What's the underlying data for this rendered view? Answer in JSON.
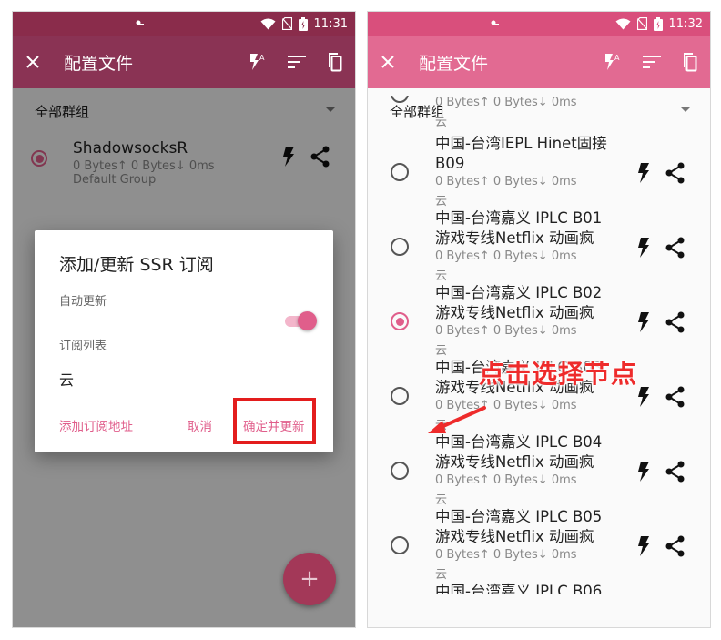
{
  "left": {
    "status": {
      "time": "11:31"
    },
    "appbar": {
      "title": "配置文件"
    },
    "group_selector": "全部群组",
    "proxy": {
      "name": "ShadowsocksR",
      "stats": "0 Bytes↑  0 Bytes↓  0ms",
      "group": "Default Group"
    },
    "dialog": {
      "title": "添加/更新 SSR 订阅",
      "auto_update_label": "自动更新",
      "auto_update_on": true,
      "sub_list_label": "订阅列表",
      "sub_list_value": "云",
      "add_url_button": "添加订阅地址",
      "cancel_button": "取消",
      "confirm_button": "确定并更新"
    },
    "fab_label": "+"
  },
  "right": {
    "status": {
      "time": "11:32"
    },
    "appbar": {
      "title": "配置文件"
    },
    "group_selector": "全部群组",
    "partial_top": {
      "stats": "0 Bytes↑  0 Bytes↓  0ms",
      "group": "云"
    },
    "nodes": [
      {
        "line1": "中国-台湾IEPL Hinet固接",
        "line2": "B09",
        "stats": "0 Bytes↑  0 Bytes↓  0ms",
        "group": "云",
        "selected": false
      },
      {
        "line1": "中国-台湾嘉义 IPLC B01",
        "line2": "游戏专线Netflix 动画疯",
        "stats": "0 Bytes↑  0 Bytes↓  0ms",
        "group": "云",
        "selected": false
      },
      {
        "line1": "中国-台湾嘉义 IPLC B02",
        "line2": "游戏专线Netflix 动画疯",
        "stats": "0 Bytes↑  0 Bytes↓  0ms",
        "group": "云",
        "selected": true
      },
      {
        "line1": "中国-台湾嘉义 IPLC B03",
        "line2": "游戏专线Netflix 动画疯",
        "stats": "0 Bytes↑  0 Bytes↓  0ms",
        "group": "云",
        "selected": false
      },
      {
        "line1": "中国-台湾嘉义 IPLC B04",
        "line2": "游戏专线Netflix 动画疯",
        "stats": "0 Bytes↑  0 Bytes↓  0ms",
        "group": "云",
        "selected": false
      },
      {
        "line1": "中国-台湾嘉义 IPLC B05",
        "line2": "游戏专线Netflix 动画疯",
        "stats": "0 Bytes↑  0 Bytes↓  0ms",
        "group": "云",
        "selected": false
      }
    ],
    "partial_bottom": "中国-台湾嘉义 IPLC B06",
    "annotation": "点击选择节点"
  },
  "colors": {
    "accent": "#e05e8b",
    "toolbar_right": "#e26a92",
    "toolbar_left": "#8a3354",
    "annotation_red": "#ee2b2b"
  },
  "icons": [
    "close-icon",
    "flash-auto-icon",
    "sort-icon",
    "copy-icon",
    "bolt-icon",
    "share-icon",
    "wifi-icon",
    "no-sim-icon",
    "battery-icon"
  ]
}
